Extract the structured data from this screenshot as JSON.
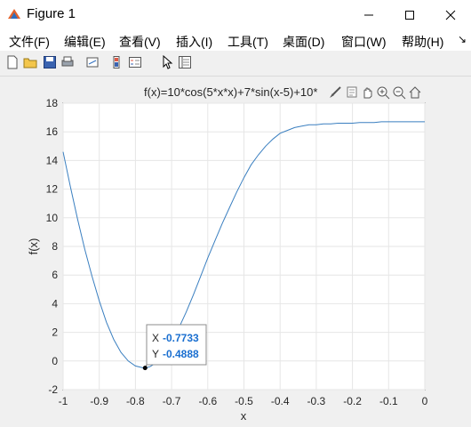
{
  "window": {
    "title": "Figure 1",
    "controls": [
      "minimize",
      "maximize",
      "close"
    ]
  },
  "menu": {
    "items": [
      "文件(F)",
      "编辑(E)",
      "查看(V)",
      "插入(I)",
      "工具(T)",
      "桌面(D)",
      "窗口(W)",
      "帮助(H)"
    ],
    "overflow": "↘"
  },
  "toolbar": {
    "icons": [
      "new-figure-icon",
      "open-file-icon",
      "save-icon",
      "print-icon",
      "link-plot-icon",
      "insert-colorbar-icon",
      "insert-legend-icon",
      "edit-plot-icon",
      "property-inspector-icon"
    ]
  },
  "axes_toolbar": {
    "icons": [
      "brush-icon",
      "data-tips-icon",
      "pan-icon",
      "zoom-in-icon",
      "zoom-out-icon",
      "home-icon"
    ]
  },
  "chart_data": {
    "type": "line",
    "title": "f(x)=10*cos(5*x*x)+7*sin(x-5)+10*",
    "xlabel": "x",
    "ylabel": "f(x)",
    "xlim": [
      -1,
      0
    ],
    "ylim": [
      -2,
      18
    ],
    "xticks": [
      "-1",
      "-0.9",
      "-0.8",
      "-0.7",
      "-0.6",
      "-0.5",
      "-0.4",
      "-0.3",
      "-0.2",
      "-0.1",
      "0"
    ],
    "yticks": [
      "-2",
      "0",
      "2",
      "4",
      "6",
      "8",
      "10",
      "12",
      "14",
      "16",
      "18"
    ],
    "grid": true,
    "series_color": "#3a7fc0",
    "series": [
      {
        "x": [
          -1.0,
          -0.98,
          -0.96,
          -0.94,
          -0.92,
          -0.9,
          -0.88,
          -0.86,
          -0.84,
          -0.82,
          -0.8,
          -0.78,
          -0.7733,
          -0.76,
          -0.74,
          -0.72,
          -0.7,
          -0.68,
          -0.66,
          -0.64,
          -0.62,
          -0.6,
          -0.58,
          -0.56,
          -0.54,
          -0.52,
          -0.5,
          -0.48,
          -0.46,
          -0.44,
          -0.42,
          -0.4,
          -0.38,
          -0.36,
          -0.34,
          -0.32,
          -0.3,
          -0.28,
          -0.26,
          -0.24,
          -0.22,
          -0.2,
          -0.18,
          -0.16,
          -0.14,
          -0.12,
          -0.1,
          -0.08,
          -0.06,
          -0.04,
          -0.02,
          0.0
        ],
        "y": [
          14.6,
          12.2,
          9.9,
          7.8,
          5.9,
          4.2,
          2.7,
          1.5,
          0.6,
          0.0,
          -0.35,
          -0.47,
          -0.4888,
          -0.4,
          -0.1,
          0.5,
          1.3,
          2.3,
          3.4,
          4.6,
          5.9,
          7.2,
          8.4,
          9.6,
          10.7,
          11.8,
          12.8,
          13.7,
          14.4,
          15.0,
          15.5,
          15.9,
          16.1,
          16.3,
          16.4,
          16.5,
          16.5,
          16.55,
          16.55,
          16.6,
          16.6,
          16.6,
          16.65,
          16.65,
          16.65,
          16.7,
          16.7,
          16.7,
          16.7,
          16.7,
          16.7,
          16.7
        ]
      }
    ],
    "datatip": {
      "x_label": "X",
      "x_value": "-0.7733",
      "y_label": "Y",
      "y_value": "-0.4888",
      "x": -0.7733,
      "y": -0.4888
    }
  }
}
